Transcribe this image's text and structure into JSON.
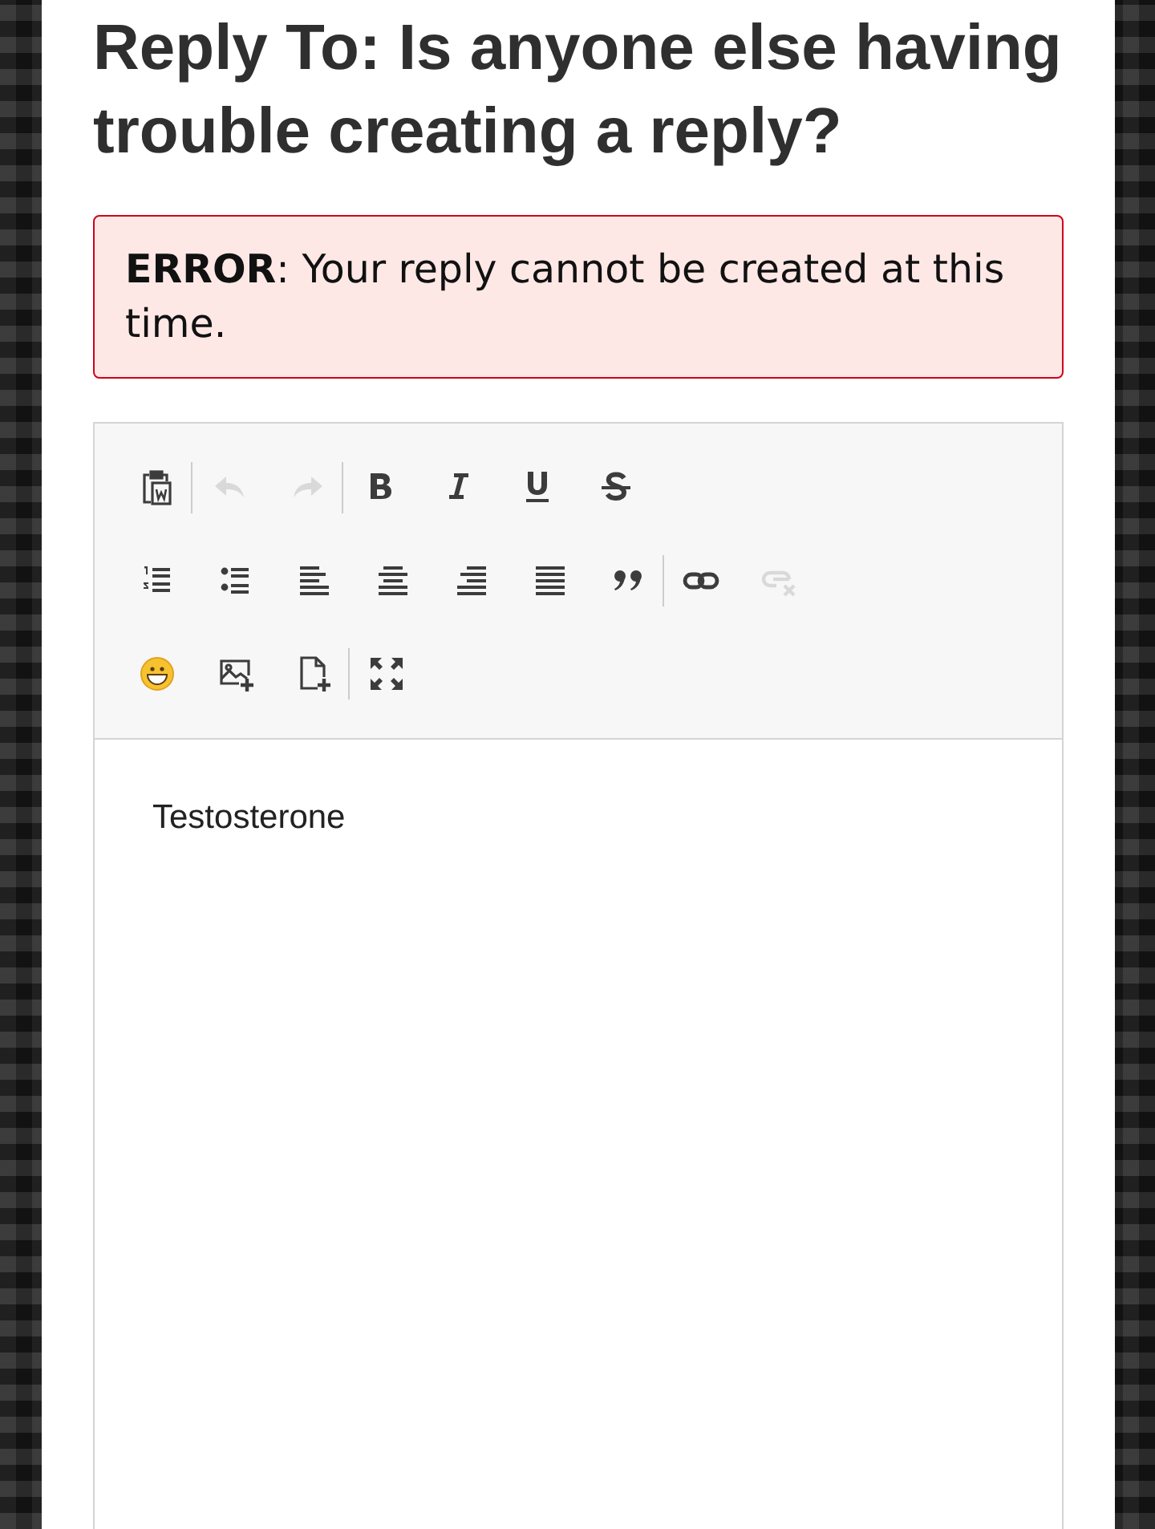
{
  "title": "Reply To: Is anyone else having trouble creating a reply?",
  "error": {
    "label": "ERROR",
    "message": ": Your reply cannot be created at this time."
  },
  "editor": {
    "toolbar": [
      [
        [
          {
            "kind": "paste-word",
            "disabled": false
          }
        ],
        [
          {
            "kind": "undo",
            "disabled": true
          },
          {
            "kind": "redo",
            "disabled": true
          }
        ],
        [
          {
            "kind": "bold",
            "disabled": false
          },
          {
            "kind": "italic",
            "disabled": false
          },
          {
            "kind": "underline",
            "disabled": false
          },
          {
            "kind": "strike",
            "disabled": false
          }
        ]
      ],
      [
        [
          {
            "kind": "ol",
            "disabled": false
          },
          {
            "kind": "ul",
            "disabled": false
          },
          {
            "kind": "left",
            "disabled": false
          },
          {
            "kind": "center",
            "disabled": false
          },
          {
            "kind": "right",
            "disabled": false
          },
          {
            "kind": "justify",
            "disabled": false
          },
          {
            "kind": "quote",
            "disabled": false
          }
        ],
        [
          {
            "kind": "link",
            "disabled": false
          },
          {
            "kind": "unlink",
            "disabled": true
          }
        ]
      ],
      [
        [
          {
            "kind": "emoji",
            "disabled": false
          },
          {
            "kind": "image",
            "disabled": false
          },
          {
            "kind": "file",
            "disabled": false
          }
        ],
        [
          {
            "kind": "fullscreen",
            "disabled": false
          }
        ]
      ]
    ],
    "content": "Testosterone"
  }
}
